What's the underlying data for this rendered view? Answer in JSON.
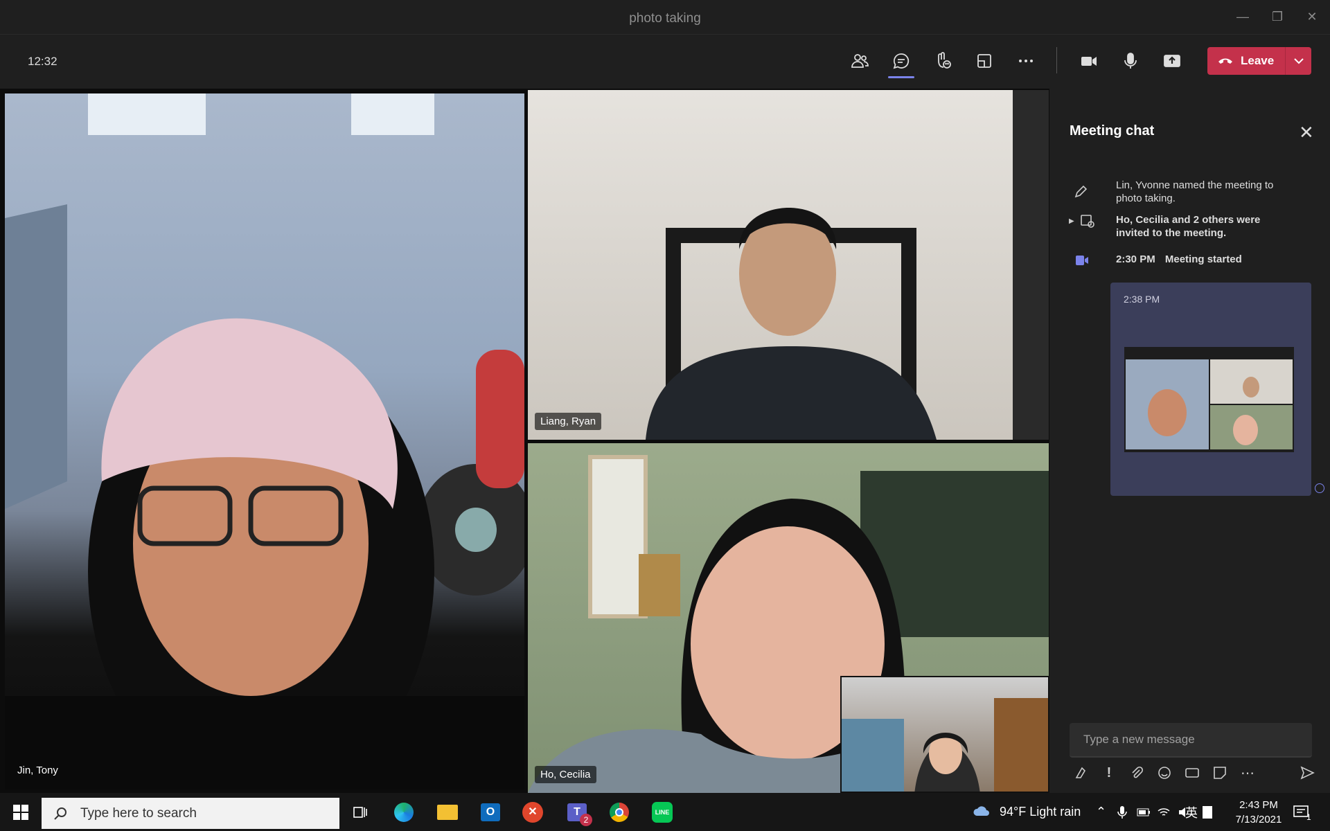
{
  "window": {
    "title": "photo taking"
  },
  "toolbar": {
    "clock": "12:32",
    "leave_label": "Leave",
    "icons": [
      "people-icon",
      "chat-icon",
      "reactions-icon",
      "rooms-icon",
      "more-icon",
      "camera-icon",
      "mic-icon",
      "share-icon"
    ]
  },
  "participants": [
    {
      "name": "Jin, Tony"
    },
    {
      "name": "Liang, Ryan"
    },
    {
      "name": "Ho, Cecilia"
    }
  ],
  "chat": {
    "title": "Meeting chat",
    "events": [
      {
        "text": "Lin, Yvonne named the meeting to photo taking."
      },
      {
        "text": "Ho, Cecilia and 2 others were invited to the meeting."
      },
      {
        "time": "2:30 PM",
        "text": "Meeting started"
      }
    ],
    "message": {
      "time": "2:38 PM"
    },
    "compose_placeholder": "Type a new message"
  },
  "taskbar": {
    "search_placeholder": "Type here to search",
    "teams_badge": "2",
    "weather": "94°F  Light rain",
    "ime": "英",
    "time": "2:43 PM",
    "date": "7/13/2021",
    "notifications": "1"
  },
  "colors": {
    "accent": "#7b83eb",
    "leave": "#c4314b",
    "chat_bubble": "#3b3e5a"
  }
}
